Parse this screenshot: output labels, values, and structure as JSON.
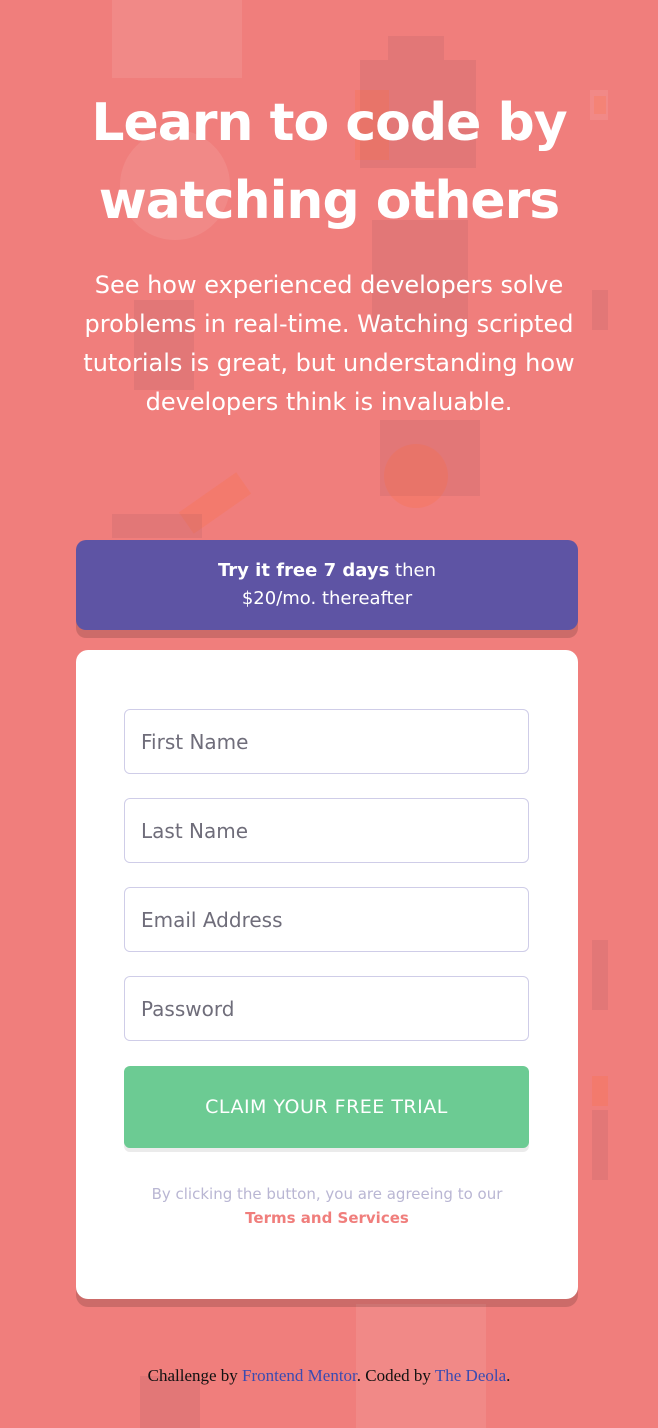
{
  "hero": {
    "title": "Learn to code by watching others",
    "description": "See how experienced developers solve problems in real-time. Watching scripted tutorials is great, but understanding how developers think is invaluable."
  },
  "promo": {
    "highlight": "Try it free 7 days",
    "rest": " then",
    "line2": "$20/mo. thereafter"
  },
  "form": {
    "first_name": {
      "value": "",
      "placeholder": "First Name"
    },
    "last_name": {
      "value": "",
      "placeholder": "Last Name"
    },
    "email": {
      "value": "",
      "placeholder": "Email Address"
    },
    "password": {
      "value": "",
      "placeholder": "Password"
    },
    "submit_label": "CLAIM YOUR FREE TRIAL",
    "terms_text": "By clicking the button, you are agreeing to our",
    "terms_link": "Terms and Services"
  },
  "footer": {
    "prefix": "Challenge by ",
    "challenge_link": "Frontend Mentor",
    "middle": ". Coded by ",
    "author_link": "The Deola",
    "suffix": "."
  },
  "colors": {
    "background": "#f07e7c",
    "promo": "#5e54a4",
    "button": "#6ccb93",
    "link_footer": "#3b4bb1"
  }
}
